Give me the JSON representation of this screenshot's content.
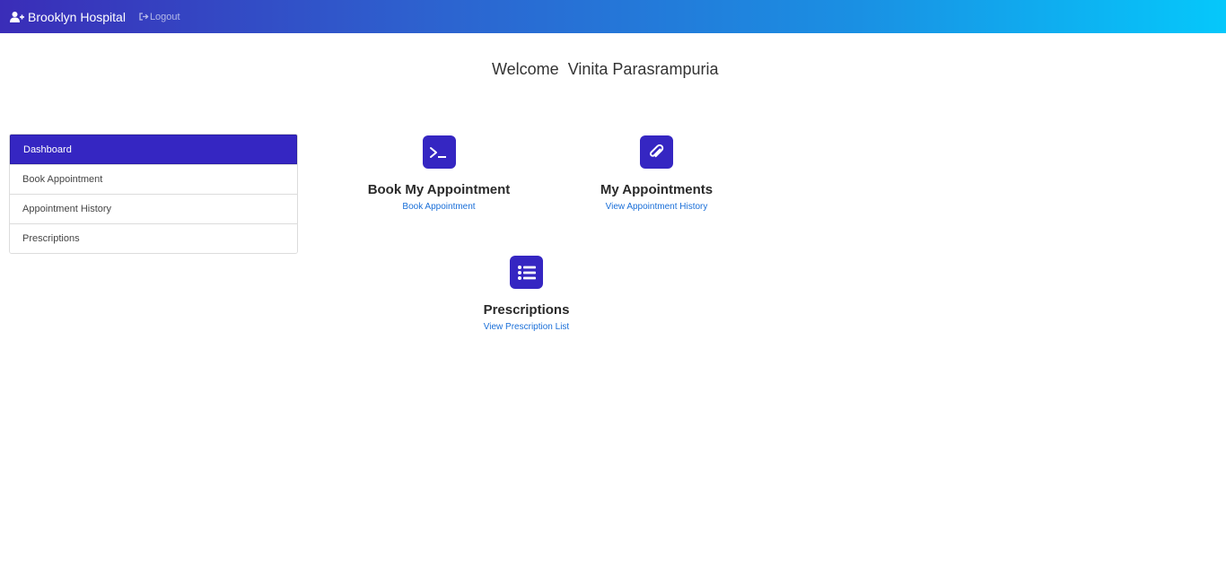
{
  "navbar": {
    "brand": "Brooklyn Hospital",
    "brand_icon": "user-plus-icon",
    "logout": "Logout",
    "logout_icon": "sign-out-icon",
    "gradient_start": "#3a2db8",
    "gradient_end": "#05c8fb"
  },
  "welcome": {
    "prefix": "Welcome",
    "user": "Vinita Parasrampuria"
  },
  "sidebar": {
    "items": [
      {
        "label": "Dashboard",
        "active": true
      },
      {
        "label": "Book Appointment",
        "active": false
      },
      {
        "label": "Appointment History",
        "active": false
      },
      {
        "label": "Prescriptions",
        "active": false
      }
    ]
  },
  "cards": [
    {
      "icon": "terminal-icon",
      "title": "Book My Appointment",
      "link": "Book Appointment"
    },
    {
      "icon": "paperclip-icon",
      "title": "My Appointments",
      "link": "View Appointment History"
    },
    {
      "icon": "list-icon",
      "title": "Prescriptions",
      "link": "View Prescription List"
    }
  ],
  "colors": {
    "accent": "#3526c2",
    "link": "#1a6fd8"
  }
}
